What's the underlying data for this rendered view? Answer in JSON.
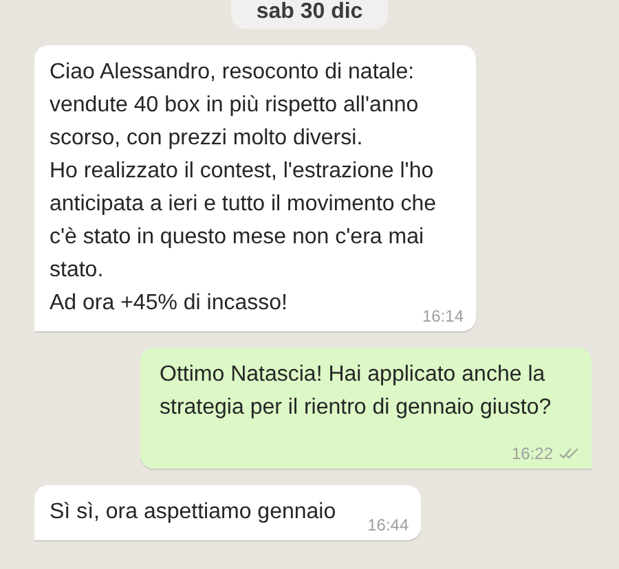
{
  "date_chip": "sab 30 dic",
  "messages": [
    {
      "kind": "incoming",
      "text": "Ciao Alessandro, resoconto di natale: vendute 40 box in più rispetto all'anno scorso, con prezzi molto diversi.\nHo realizzato il contest, l'estrazione l'ho anticipata a ieri e tutto il movimento che c'è stato in questo mese non c'era mai stato.\nAd ora +45% di incasso!",
      "time": "16:14"
    },
    {
      "kind": "outgoing",
      "text": "Ottimo Natascia! Hai applicato anche la strategia per il rientro di gennaio giusto?",
      "time": "16:22",
      "read": false
    },
    {
      "kind": "incoming",
      "text": "Sì sì, ora aspettiamo gennaio",
      "time": "16:44"
    }
  ]
}
